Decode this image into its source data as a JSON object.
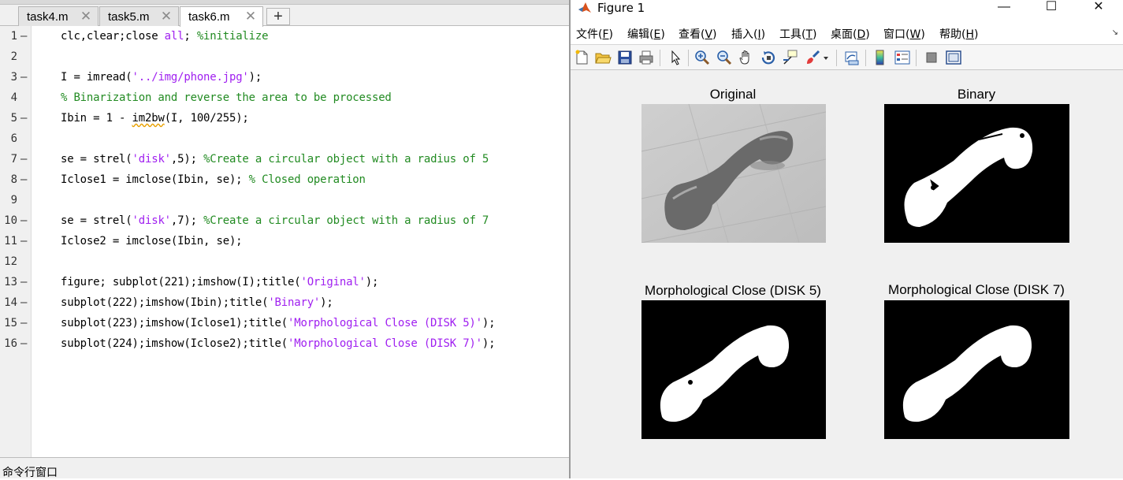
{
  "editor": {
    "tabs": [
      {
        "label": "task4.m"
      },
      {
        "label": "task5.m"
      },
      {
        "label": "task6.m"
      }
    ],
    "tab_close_glyph": "✕",
    "add_tab_glyph": "+",
    "code_lines": [
      {
        "num": "1",
        "dash": "—"
      },
      {
        "num": "2"
      },
      {
        "num": "3",
        "dash": "—"
      },
      {
        "num": "4"
      },
      {
        "num": "5",
        "dash": "—"
      },
      {
        "num": "6"
      },
      {
        "num": "7",
        "dash": "—"
      },
      {
        "num": "8",
        "dash": "—"
      },
      {
        "num": "9"
      },
      {
        "num": "10",
        "dash": "—"
      },
      {
        "num": "11",
        "dash": "—"
      },
      {
        "num": "12"
      },
      {
        "num": "13",
        "dash": "—"
      },
      {
        "num": "14",
        "dash": "—"
      },
      {
        "num": "15",
        "dash": "—"
      },
      {
        "num": "16",
        "dash": "—"
      }
    ],
    "tokens": {
      "l1a": "clc,clear;close ",
      "l1b": "all",
      "l1c": "; ",
      "l1d": "%initialize",
      "l3a": "I = imread(",
      "l3b": "'../img/phone.jpg'",
      "l3c": ");",
      "l4a": "% Binarization and reverse the area to be processed",
      "l5a": "Ibin = 1 - ",
      "l5b": "im2bw",
      "l5c": "(I, 100/255);",
      "l7a": "se = strel(",
      "l7b": "'disk'",
      "l7c": ",5); ",
      "l7d": "%Create a circular object with a radius of 5",
      "l8a": "Iclose1 = imclose(Ibin, se); ",
      "l8b": "% Closed operation",
      "l10a": "se = strel(",
      "l10b": "'disk'",
      "l10c": ",7); ",
      "l10d": "%Create a circular object with a radius of 7",
      "l11a": "Iclose2 = imclose(Ibin, se);",
      "l13a": "figure; subplot(221);imshow(I);title(",
      "l13b": "'Original'",
      "l13c": ");",
      "l14a": "subplot(222);imshow(Ibin);title(",
      "l14b": "'Binary'",
      "l14c": ");",
      "l15a": "subplot(223);imshow(Iclose1);title(",
      "l15b": "'Morphological Close (DISK 5)'",
      "l15c": ");",
      "l16a": "subplot(224);imshow(Iclose2);title(",
      "l16b": "'Morphological Close (DISK 7)'",
      "l16c": ");"
    },
    "command_window_title": "命令行窗口"
  },
  "figure": {
    "title": "Figure 1",
    "window_buttons": {
      "minimize": "—",
      "maximize": "☐",
      "close": "✕"
    },
    "menus": [
      {
        "label": "文件(",
        "key": "F",
        "end": ")"
      },
      {
        "label": "编辑(",
        "key": "E",
        "end": ")"
      },
      {
        "label": "查看(",
        "key": "V",
        "end": ")"
      },
      {
        "label": "插入(",
        "key": "I",
        "end": ")"
      },
      {
        "label": "工具(",
        "key": "T",
        "end": ")"
      },
      {
        "label": "桌面(",
        "key": "D",
        "end": ")"
      },
      {
        "label": "窗口(",
        "key": "W",
        "end": ")"
      },
      {
        "label": "帮助(",
        "key": "H",
        "end": ")"
      }
    ],
    "menu_overflow_glyph": "↘",
    "toolbar_icons": [
      "new-figure-icon",
      "open-file-icon",
      "save-icon",
      "print-icon",
      "pointer-icon",
      "zoom-in-icon",
      "zoom-out-icon",
      "pan-hand-icon",
      "rotate-3d-icon",
      "data-cursor-icon",
      "brush-icon",
      "link-plot-icon",
      "colorbar-icon",
      "legend-icon",
      "hide-plot-tools-icon",
      "show-plot-tools-icon"
    ],
    "subplots": [
      {
        "title": "Original"
      },
      {
        "title": "Binary"
      },
      {
        "title": "Morphological Close (DISK 5)"
      },
      {
        "title": "Morphological Close (DISK 7)"
      }
    ],
    "colors": {
      "accent_icon_orange": "#e07b00",
      "comment_green": "#228b22",
      "string_purple": "#a020f0"
    }
  }
}
